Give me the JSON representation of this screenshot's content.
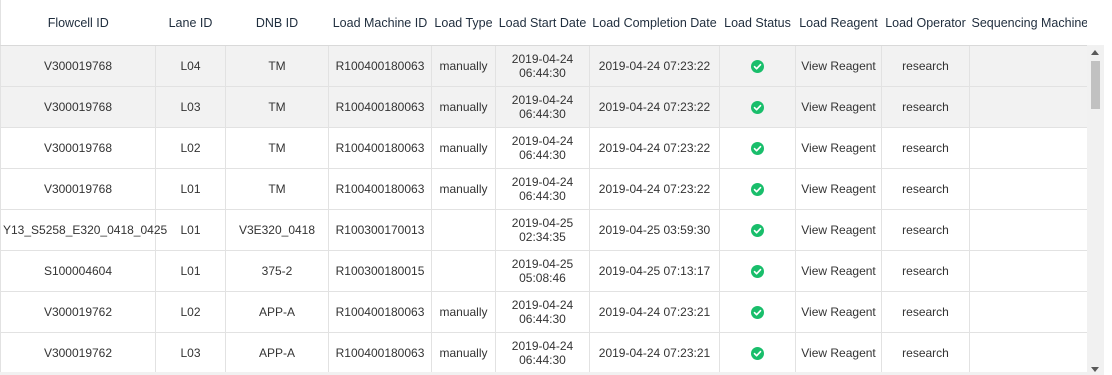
{
  "columns": [
    "Flowcell ID",
    "Lane ID",
    "DNB ID",
    "Load Machine ID",
    "Load Type",
    "Load Start Date",
    "Load Completion Date",
    "Load Status",
    "Load Reagent",
    "Load Operator",
    "Sequencing Machine T"
  ],
  "rows": [
    {
      "flowcell": "V300019768",
      "lane": "L04",
      "dnb": "TM",
      "machine": "R100400180063",
      "type": "manually",
      "start_date": "2019-04-24",
      "start_time": "06:44:30",
      "completion": "2019-04-24 07:23:22",
      "status": "success",
      "reagent": "View Reagent",
      "operator": "research",
      "sequencing": ""
    },
    {
      "flowcell": "V300019768",
      "lane": "L03",
      "dnb": "TM",
      "machine": "R100400180063",
      "type": "manually",
      "start_date": "2019-04-24",
      "start_time": "06:44:30",
      "completion": "2019-04-24 07:23:22",
      "status": "success",
      "reagent": "View Reagent",
      "operator": "research",
      "sequencing": ""
    },
    {
      "flowcell": "V300019768",
      "lane": "L02",
      "dnb": "TM",
      "machine": "R100400180063",
      "type": "manually",
      "start_date": "2019-04-24",
      "start_time": "06:44:30",
      "completion": "2019-04-24 07:23:22",
      "status": "success",
      "reagent": "View Reagent",
      "operator": "research",
      "sequencing": ""
    },
    {
      "flowcell": "V300019768",
      "lane": "L01",
      "dnb": "TM",
      "machine": "R100400180063",
      "type": "manually",
      "start_date": "2019-04-24",
      "start_time": "06:44:30",
      "completion": "2019-04-24 07:23:22",
      "status": "success",
      "reagent": "View Reagent",
      "operator": "research",
      "sequencing": ""
    },
    {
      "flowcell": "Y13_S5258_E320_0418_0425",
      "lane": "L01",
      "dnb": "V3E320_0418",
      "machine": "R100300170013",
      "type": "",
      "start_date": "2019-04-25",
      "start_time": "02:34:35",
      "completion": "2019-04-25 03:59:30",
      "status": "success",
      "reagent": "View Reagent",
      "operator": "research",
      "sequencing": ""
    },
    {
      "flowcell": "S100004604",
      "lane": "L01",
      "dnb": "375-2",
      "machine": "R100300180015",
      "type": "",
      "start_date": "2019-04-25",
      "start_time": "05:08:46",
      "completion": "2019-04-25 07:13:17",
      "status": "success",
      "reagent": "View Reagent",
      "operator": "research",
      "sequencing": ""
    },
    {
      "flowcell": "V300019762",
      "lane": "L02",
      "dnb": "APP-A",
      "machine": "R100400180063",
      "type": "manually",
      "start_date": "2019-04-24",
      "start_time": "06:44:30",
      "completion": "2019-04-24 07:23:21",
      "status": "success",
      "reagent": "View Reagent",
      "operator": "research",
      "sequencing": ""
    },
    {
      "flowcell": "V300019762",
      "lane": "L03",
      "dnb": "APP-A",
      "machine": "R100400180063",
      "type": "manually",
      "start_date": "2019-04-24",
      "start_time": "06:44:30",
      "completion": "2019-04-24 07:23:21",
      "status": "success",
      "reagent": "View Reagent",
      "operator": "research",
      "sequencing": ""
    }
  ],
  "colors": {
    "status_success": "#19be6b",
    "row_shade": "#f2f2f2",
    "border": "#e2e2e2"
  },
  "icons": {
    "status": "check-circle-icon"
  }
}
